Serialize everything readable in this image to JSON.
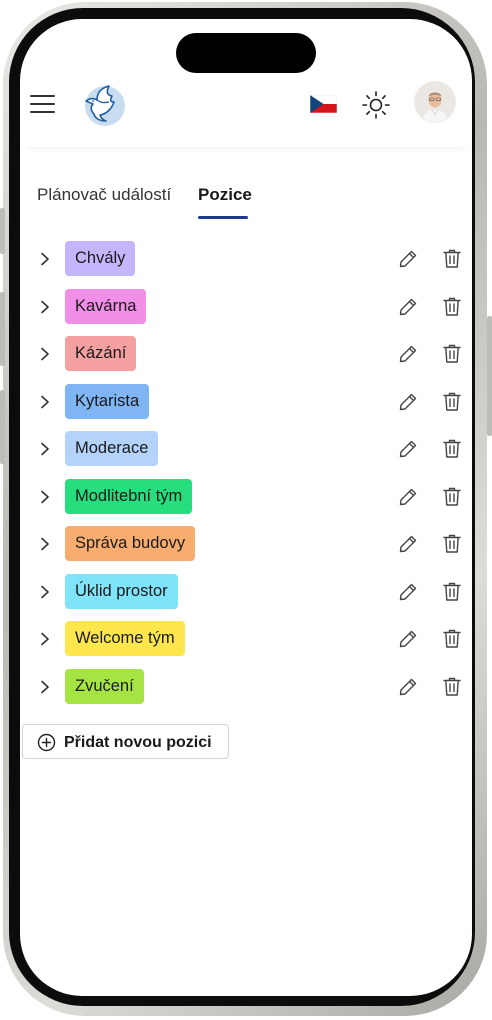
{
  "header": {
    "menu_icon": "hamburger-menu-icon",
    "logo_icon": "dove-logo-icon",
    "language_flag": "czech-flag-icon",
    "theme_icon": "sun-icon",
    "avatar": "user-avatar"
  },
  "tabs": [
    {
      "label": "Plánovač událostí",
      "active": false
    },
    {
      "label": "Pozice",
      "active": true
    }
  ],
  "positions": [
    {
      "label": "Chvály",
      "color": "#c4b5fd"
    },
    {
      "label": "Kavárna",
      "color": "#f08ee8"
    },
    {
      "label": "Kázání",
      "color": "#f4a0a0"
    },
    {
      "label": "Kytarista",
      "color": "#7fb4f5"
    },
    {
      "label": "Moderace",
      "color": "#b3d3fb"
    },
    {
      "label": "Modlitební tým",
      "color": "#27de7e"
    },
    {
      "label": "Správa budovy",
      "color": "#f7ad70"
    },
    {
      "label": "Úklid prostor",
      "color": "#7fe3fa"
    },
    {
      "label": "Welcome tým",
      "color": "#fde74d"
    },
    {
      "label": "Zvučení",
      "color": "#a6e444"
    }
  ],
  "row_icons": {
    "expand": "chevron-right-icon",
    "edit": "pencil-icon",
    "delete": "trash-icon"
  },
  "add_button": {
    "label": "Přidat novou pozici",
    "icon": "plus-circle-icon"
  }
}
